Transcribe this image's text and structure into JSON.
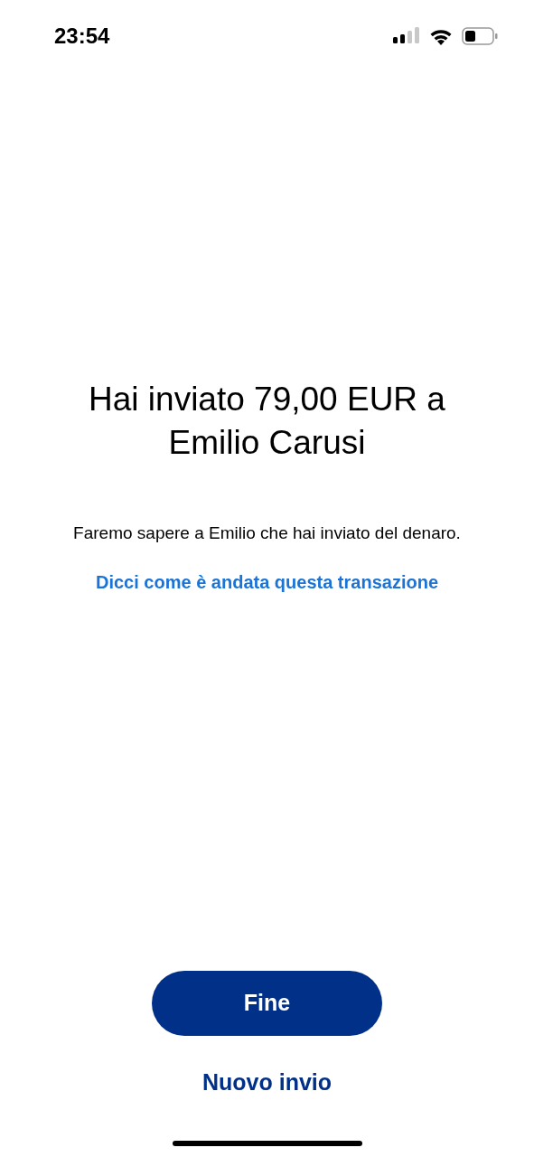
{
  "status_bar": {
    "time": "23:54"
  },
  "title": "Hai inviato 79,00 EUR a Emilio Carusi",
  "message": "Faremo sapere a Emilio che hai inviato del denaro.",
  "feedback_link": "Dicci come è andata questa transazione",
  "primary_button": "Fine",
  "secondary_link": "Nuovo invio"
}
